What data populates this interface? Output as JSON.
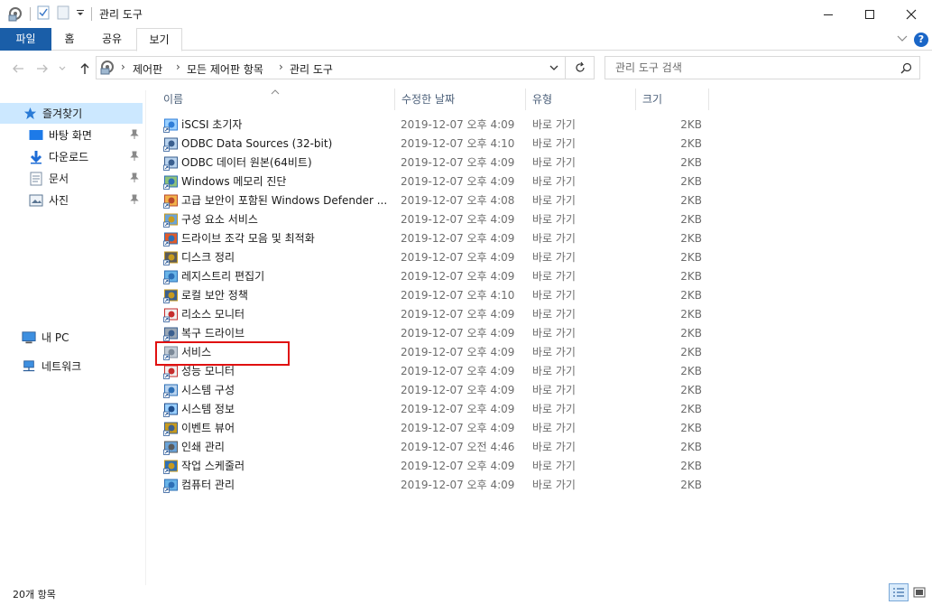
{
  "window": {
    "title": "관리 도구"
  },
  "ribbon": {
    "tabs": [
      "파일",
      "홈",
      "공유",
      "보기"
    ],
    "help_label": "?"
  },
  "address": {
    "crumbs": [
      "제어판",
      "모든 제어판 항목",
      "관리 도구"
    ],
    "separator": "›"
  },
  "search": {
    "placeholder": "관리 도구 검색"
  },
  "nav": {
    "quick_access": "즐겨찾기",
    "pinned": [
      {
        "label": "바탕 화면",
        "icon": "desktop-icon"
      },
      {
        "label": "다운로드",
        "icon": "download-icon"
      },
      {
        "label": "문서",
        "icon": "documents-icon"
      },
      {
        "label": "사진",
        "icon": "pictures-icon"
      }
    ],
    "this_pc": "내 PC",
    "network": "네트워크"
  },
  "columns": {
    "name": "이름",
    "date": "수정한 날짜",
    "type": "유형",
    "size": "크기"
  },
  "files": [
    {
      "name": "iSCSI 초기자",
      "date": "2019-12-07 오후 4:09",
      "type": "바로 가기",
      "size": "2KB",
      "icon": "iscsi-icon"
    },
    {
      "name": "ODBC Data Sources (32-bit)",
      "date": "2019-12-07 오후 4:10",
      "type": "바로 가기",
      "size": "2KB",
      "icon": "odbc-icon"
    },
    {
      "name": "ODBC 데이터 원본(64비트)",
      "date": "2019-12-07 오후 4:09",
      "type": "바로 가기",
      "size": "2KB",
      "icon": "odbc-icon"
    },
    {
      "name": "Windows 메모리 진단",
      "date": "2019-12-07 오후 4:09",
      "type": "바로 가기",
      "size": "2KB",
      "icon": "memory-diagnostic-icon"
    },
    {
      "name": "고급 보안이 포함된 Windows Defender ...",
      "date": "2019-12-07 오후 4:08",
      "type": "바로 가기",
      "size": "2KB",
      "icon": "firewall-icon"
    },
    {
      "name": "구성 요소 서비스",
      "date": "2019-12-07 오후 4:09",
      "type": "바로 가기",
      "size": "2KB",
      "icon": "component-services-icon"
    },
    {
      "name": "드라이브 조각 모음 및 최적화",
      "date": "2019-12-07 오후 4:09",
      "type": "바로 가기",
      "size": "2KB",
      "icon": "defrag-icon"
    },
    {
      "name": "디스크 정리",
      "date": "2019-12-07 오후 4:09",
      "type": "바로 가기",
      "size": "2KB",
      "icon": "disk-cleanup-icon"
    },
    {
      "name": "레지스트리 편집기",
      "date": "2019-12-07 오후 4:09",
      "type": "바로 가기",
      "size": "2KB",
      "icon": "registry-icon"
    },
    {
      "name": "로컬 보안 정책",
      "date": "2019-12-07 오후 4:10",
      "type": "바로 가기",
      "size": "2KB",
      "icon": "security-policy-icon"
    },
    {
      "name": "리소스 모니터",
      "date": "2019-12-07 오후 4:09",
      "type": "바로 가기",
      "size": "2KB",
      "icon": "resource-monitor-icon"
    },
    {
      "name": "복구 드라이브",
      "date": "2019-12-07 오후 4:09",
      "type": "바로 가기",
      "size": "2KB",
      "icon": "recovery-drive-icon"
    },
    {
      "name": "서비스",
      "date": "2019-12-07 오후 4:09",
      "type": "바로 가기",
      "size": "2KB",
      "icon": "services-icon"
    },
    {
      "name": "성능 모니터",
      "date": "2019-12-07 오후 4:09",
      "type": "바로 가기",
      "size": "2KB",
      "icon": "performance-monitor-icon"
    },
    {
      "name": "시스템 구성",
      "date": "2019-12-07 오후 4:09",
      "type": "바로 가기",
      "size": "2KB",
      "icon": "system-config-icon"
    },
    {
      "name": "시스템 정보",
      "date": "2019-12-07 오후 4:09",
      "type": "바로 가기",
      "size": "2KB",
      "icon": "system-info-icon"
    },
    {
      "name": "이벤트 뷰어",
      "date": "2019-12-07 오후 4:09",
      "type": "바로 가기",
      "size": "2KB",
      "icon": "event-viewer-icon"
    },
    {
      "name": "인쇄 관리",
      "date": "2019-12-07 오전 4:46",
      "type": "바로 가기",
      "size": "2KB",
      "icon": "print-management-icon"
    },
    {
      "name": "작업 스케줄러",
      "date": "2019-12-07 오후 4:09",
      "type": "바로 가기",
      "size": "2KB",
      "icon": "task-scheduler-icon"
    },
    {
      "name": "컴퓨터 관리",
      "date": "2019-12-07 오후 4:09",
      "type": "바로 가기",
      "size": "2KB",
      "icon": "computer-management-icon"
    }
  ],
  "status": {
    "item_count": "20개 항목"
  },
  "colors": {
    "file_tab": "#1a5ea8",
    "selection": "#cce8ff",
    "highlight": "#e01010",
    "header_text": "#4c607a"
  }
}
